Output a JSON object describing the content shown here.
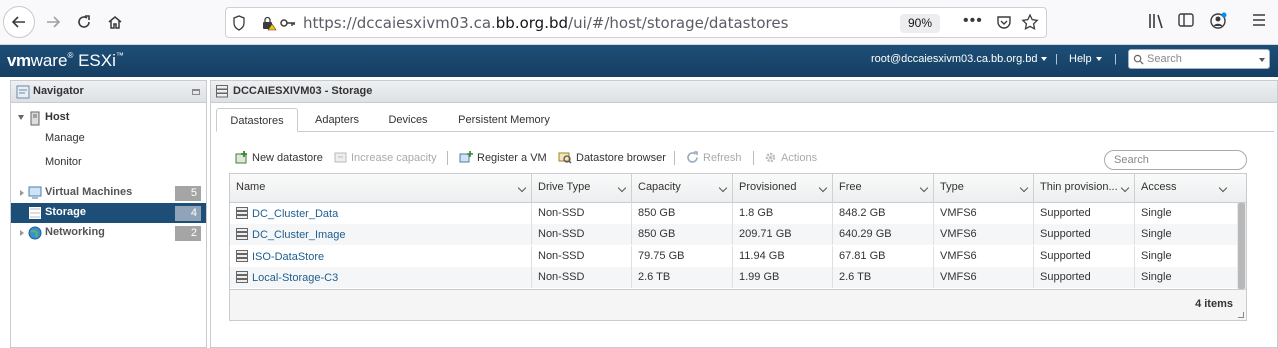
{
  "browser": {
    "url_prefix": "https://dccaiesxivm03.ca.",
    "url_domain": "bb.org.bd",
    "url_path": "/ui/#/host/storage/datastores",
    "zoom": "90%"
  },
  "esxi": {
    "logo_vm": "vm",
    "logo_ware": "ware",
    "logo_product": "ESXi",
    "user": "root@dccaiesxivm03.ca.bb.org.bd",
    "help": "Help",
    "search_placeholder": "Search"
  },
  "navigator": {
    "title": "Navigator",
    "items": [
      {
        "label": "Host",
        "badge": ""
      },
      {
        "label": "Manage",
        "badge": ""
      },
      {
        "label": "Monitor",
        "badge": ""
      },
      {
        "label": "Virtual Machines",
        "badge": "5"
      },
      {
        "label": "Storage",
        "badge": "4"
      },
      {
        "label": "Networking",
        "badge": "2"
      }
    ]
  },
  "main": {
    "title": "DCCAIESXIVM03 - Storage",
    "tabs": [
      "Datastores",
      "Adapters",
      "Devices",
      "Persistent Memory"
    ],
    "toolbar": {
      "new_datastore": "New datastore",
      "increase_capacity": "Increase capacity",
      "register_vm": "Register a VM",
      "datastore_browser": "Datastore browser",
      "refresh": "Refresh",
      "actions": "Actions"
    },
    "search_placeholder": "Search",
    "columns": [
      "Name",
      "Drive Type",
      "Capacity",
      "Provisioned",
      "Free",
      "Type",
      "Thin provision...",
      "Access"
    ],
    "rows": [
      [
        "DC_Cluster_Data",
        "Non-SSD",
        "850 GB",
        "1.8 GB",
        "848.2 GB",
        "VMFS6",
        "Supported",
        "Single"
      ],
      [
        "DC_Cluster_Image",
        "Non-SSD",
        "850 GB",
        "209.71 GB",
        "640.29 GB",
        "VMFS6",
        "Supported",
        "Single"
      ],
      [
        "ISO-DataStore",
        "Non-SSD",
        "79.75 GB",
        "11.94 GB",
        "67.81 GB",
        "VMFS6",
        "Supported",
        "Single"
      ],
      [
        "Local-Storage-C3",
        "Non-SSD",
        "2.6 TB",
        "1.99 GB",
        "2.6 TB",
        "VMFS6",
        "Supported",
        "Single"
      ]
    ],
    "item_count": "4 items"
  }
}
